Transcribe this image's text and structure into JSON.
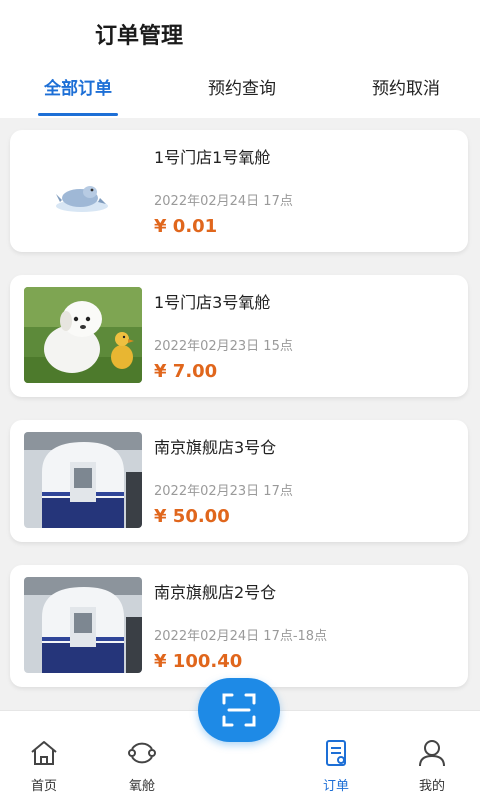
{
  "header": {
    "title": "订单管理"
  },
  "tabs": [
    {
      "label": "全部订单",
      "active": true
    },
    {
      "label": "预约查询",
      "active": false
    },
    {
      "label": "预约取消",
      "active": false
    }
  ],
  "orders": [
    {
      "title": "1号门店1号氧舱",
      "time": "2022年02月24日 17点",
      "price": "¥ 0.01",
      "thumb": "seal-icon"
    },
    {
      "title": "1号门店3号氧舱",
      "time": "2022年02月23日 15点",
      "price": "¥ 7.00",
      "thumb": "puppy-photo"
    },
    {
      "title": "南京旗舰店3号仓",
      "time": "2022年02月23日 17点",
      "price": "¥ 50.00",
      "thumb": "chamber-photo"
    },
    {
      "title": "南京旗舰店2号仓",
      "time": "2022年02月24日 17点-18点",
      "price": "¥ 100.40",
      "thumb": "chamber-photo"
    }
  ],
  "bottom_nav": [
    {
      "label": "首页",
      "icon": "home-icon",
      "active": false
    },
    {
      "label": "氧舱",
      "icon": "cabin-icon",
      "active": false
    },
    {
      "label": "订单",
      "icon": "order-icon",
      "active": true
    },
    {
      "label": "我的",
      "icon": "profile-icon",
      "active": false
    }
  ],
  "scan_button": {
    "icon": "scan-icon"
  },
  "colors": {
    "accent": "#1d6fd6",
    "price": "#e0661c",
    "scan": "#1e8ae6"
  }
}
